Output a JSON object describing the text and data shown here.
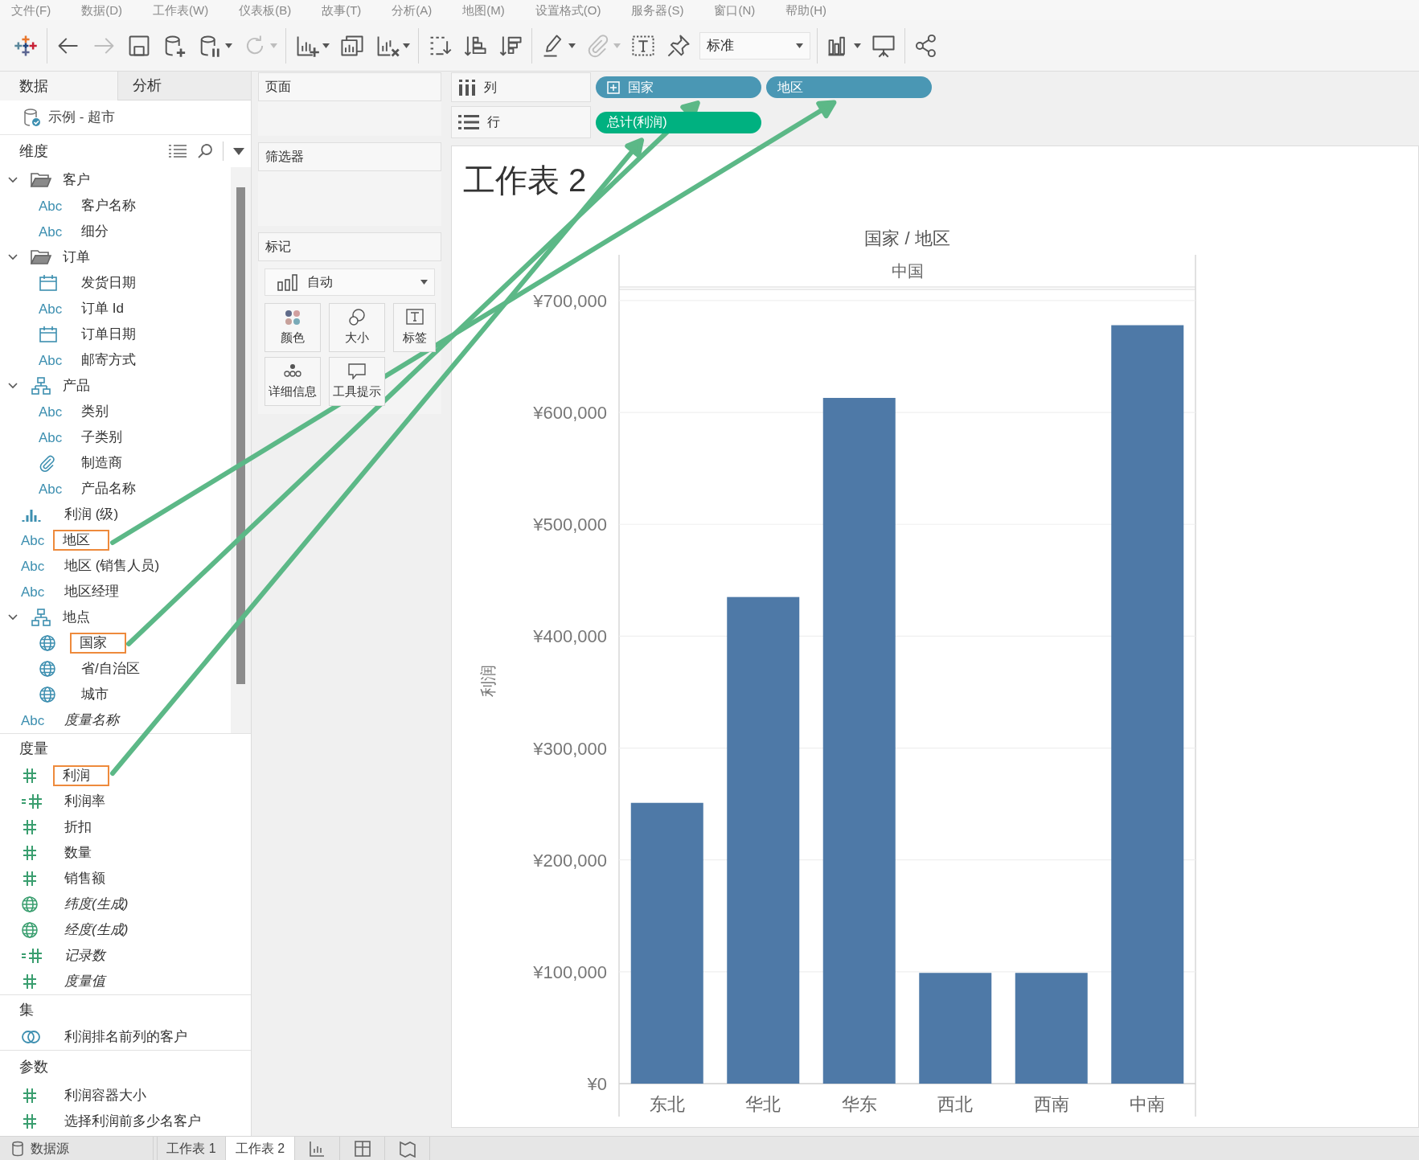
{
  "menu": [
    "文件(F)",
    "数据(D)",
    "工作表(W)",
    "仪表板(B)",
    "故事(T)",
    "分析(A)",
    "地图(M)",
    "设置格式(O)",
    "服务器(S)",
    "窗口(N)",
    "帮助(H)"
  ],
  "toolbar": [
    [
      {
        "kind": "logo",
        "menu": false
      }
    ],
    [
      {
        "kind": "back",
        "disabled": false,
        "menu": false
      },
      {
        "kind": "forward",
        "disabled": true,
        "menu": false
      },
      {
        "kind": "save",
        "disabled": false,
        "menu": false
      },
      {
        "kind": "new-datasource",
        "disabled": false,
        "menu": false
      },
      {
        "kind": "pause",
        "disabled": false,
        "menu": true
      },
      {
        "kind": "refresh",
        "disabled": true,
        "menu": true
      }
    ],
    [
      {
        "kind": "new-sheet",
        "disabled": false,
        "menu": true
      },
      {
        "kind": "duplicate",
        "disabled": false,
        "menu": false
      },
      {
        "kind": "clear",
        "disabled": false,
        "menu": true
      }
    ],
    [
      {
        "kind": "swap",
        "disabled": false,
        "menu": false
      },
      {
        "kind": "sort-asc",
        "disabled": false,
        "menu": false
      },
      {
        "kind": "sort-desc",
        "disabled": false,
        "menu": false
      }
    ],
    [
      {
        "kind": "highlight",
        "disabled": false,
        "menu": true
      },
      {
        "kind": "annotate",
        "disabled": true,
        "menu": true
      },
      {
        "kind": "labels",
        "disabled": false,
        "menu": false
      },
      {
        "kind": "pin",
        "disabled": false,
        "menu": false
      },
      {
        "kind": "fit",
        "value": "标准",
        "disabled": false,
        "menu": true
      }
    ],
    [
      {
        "kind": "show-me",
        "disabled": false,
        "menu": true
      },
      {
        "kind": "presentation",
        "disabled": false,
        "menu": false
      }
    ],
    [
      {
        "kind": "share",
        "disabled": false,
        "menu": false
      }
    ]
  ],
  "left_panel": {
    "tabs": [
      {
        "label": "数据",
        "selected": true
      },
      {
        "label": "分析",
        "selected": false
      }
    ],
    "data_source": "示例 - 超市",
    "sections": [
      {
        "title": "维度",
        "color": "#3d8fb0",
        "has_tools": true,
        "items": [
          {
            "kind": "folder",
            "label": "客户",
            "expanded": true,
            "children": [
              {
                "kind": "text",
                "badge": "Abc",
                "label": "客户名称",
                "italic": false,
                "highlighted": false
              },
              {
                "kind": "text",
                "badge": "Abc",
                "label": "细分",
                "italic": false,
                "highlighted": false
              }
            ]
          },
          {
            "kind": "folder",
            "label": "订单",
            "expanded": true,
            "children": [
              {
                "kind": "date",
                "label": "发货日期",
                "italic": false,
                "highlighted": false
              },
              {
                "kind": "text",
                "badge": "Abc",
                "label": "订单 Id",
                "italic": false,
                "highlighted": false
              },
              {
                "kind": "date",
                "label": "订单日期",
                "italic": false,
                "highlighted": false
              },
              {
                "kind": "text",
                "badge": "Abc",
                "label": "邮寄方式",
                "italic": false,
                "highlighted": false
              }
            ]
          },
          {
            "kind": "hierarchy",
            "label": "产品",
            "expanded": true,
            "children": [
              {
                "kind": "text",
                "badge": "Abc",
                "label": "类别",
                "italic": false,
                "highlighted": false
              },
              {
                "kind": "text",
                "badge": "Abc",
                "label": "子类别",
                "italic": false,
                "highlighted": false
              },
              {
                "kind": "attachment",
                "label": "制造商",
                "italic": false,
                "highlighted": false
              },
              {
                "kind": "text",
                "badge": "Abc",
                "label": "产品名称",
                "italic": false,
                "highlighted": false
              }
            ]
          },
          {
            "kind": "bin",
            "label": "利润 (级)",
            "italic": false,
            "highlighted": false
          },
          {
            "kind": "text",
            "badge": "Abc",
            "label": "地区",
            "italic": false,
            "highlighted": true
          },
          {
            "kind": "text",
            "badge": "Abc",
            "label": "地区 (销售人员)",
            "italic": false,
            "highlighted": false
          },
          {
            "kind": "text",
            "badge": "Abc",
            "label": "地区经理",
            "italic": false,
            "highlighted": false
          },
          {
            "kind": "hierarchy",
            "label": "地点",
            "expanded": true,
            "children": [
              {
                "kind": "geo",
                "label": "国家",
                "italic": false,
                "highlighted": true
              },
              {
                "kind": "geo",
                "label": "省/自治区",
                "italic": false,
                "highlighted": false
              },
              {
                "kind": "geo",
                "label": "城市",
                "italic": false,
                "highlighted": false
              }
            ]
          },
          {
            "kind": "text",
            "badge": "Abc",
            "label": "度量名称",
            "italic": true,
            "highlighted": false
          }
        ]
      },
      {
        "title": "度量",
        "color": "#3a9e6f",
        "has_tools": false,
        "items": [
          {
            "kind": "number",
            "label": "利润",
            "italic": false,
            "highlighted": true
          },
          {
            "kind": "calc-number",
            "label": "利润率",
            "italic": false,
            "highlighted": false
          },
          {
            "kind": "number",
            "label": "折扣",
            "italic": false,
            "highlighted": false
          },
          {
            "kind": "number",
            "label": "数量",
            "italic": false,
            "highlighted": false
          },
          {
            "kind": "number",
            "label": "销售额",
            "italic": false,
            "highlighted": false
          },
          {
            "kind": "geo",
            "label": "纬度(生成)",
            "italic": true,
            "highlighted": false
          },
          {
            "kind": "geo",
            "label": "经度(生成)",
            "italic": true,
            "highlighted": false
          },
          {
            "kind": "calc-number",
            "label": "记录数",
            "italic": true,
            "highlighted": false
          },
          {
            "kind": "number",
            "label": "度量值",
            "italic": true,
            "highlighted": false
          }
        ]
      },
      {
        "title": "集",
        "color": "#3d8fb0",
        "has_tools": false,
        "items": [
          {
            "kind": "set",
            "label": "利润排名前列的客户",
            "italic": false,
            "highlighted": false
          }
        ]
      },
      {
        "title": "参数",
        "color": "#3a9e6f",
        "has_tools": false,
        "items": [
          {
            "kind": "number",
            "label": "利润容器大小",
            "italic": false,
            "highlighted": false
          },
          {
            "kind": "number",
            "label": "选择利润前多少名客户",
            "italic": false,
            "highlighted": false
          }
        ]
      }
    ]
  },
  "cards": {
    "pages": "页面",
    "filters": "筛选器",
    "marks": {
      "title": "标记",
      "mark_type": "自动",
      "buttons": [
        {
          "kind": "color",
          "label": "颜色"
        },
        {
          "kind": "size",
          "label": "大小"
        },
        {
          "kind": "label",
          "label": "标签"
        },
        {
          "kind": "detail",
          "label": "详细信息"
        },
        {
          "kind": "tooltip",
          "label": "工具提示"
        }
      ]
    }
  },
  "shelves": [
    {
      "kind": "columns",
      "label": "列",
      "pills": [
        {
          "label": "国家",
          "color": "#4a97b4",
          "expandable": true
        },
        {
          "label": "地区",
          "color": "#4a97b4",
          "expandable": false
        }
      ]
    },
    {
      "kind": "rows",
      "label": "行",
      "pills": [
        {
          "label": "总计(利润)",
          "color": "#00b180",
          "expandable": false
        }
      ]
    }
  ],
  "sheet": {
    "title": "工作表 2",
    "header": "国家 / 地区",
    "pane": "中国",
    "chart_data": {
      "type": "bar",
      "ylabel": "利润",
      "categories": [
        "东北",
        "华北",
        "华东",
        "西北",
        "西南",
        "中南"
      ],
      "series": [
        {
          "color": "#4e79a7",
          "values": [
            251000,
            435000,
            613000,
            99000,
            99000,
            678000
          ]
        }
      ],
      "ylim": [
        0,
        710000
      ],
      "grid": true,
      "yticks": [
        {
          "value": 0,
          "label": "¥0"
        },
        {
          "value": 100000,
          "label": "¥100,000"
        },
        {
          "value": 200000,
          "label": "¥200,000"
        },
        {
          "value": 300000,
          "label": "¥300,000"
        },
        {
          "value": 400000,
          "label": "¥400,000"
        },
        {
          "value": 500000,
          "label": "¥500,000"
        },
        {
          "value": 600000,
          "label": "¥600,000"
        },
        {
          "value": 700000,
          "label": "¥700,000"
        }
      ]
    }
  },
  "bottom_tabs": [
    {
      "kind": "data-source",
      "label": "数据源",
      "selected": false
    },
    {
      "kind": "sheet",
      "label": "工作表 1",
      "selected": false
    },
    {
      "kind": "sheet",
      "label": "工作表 2",
      "selected": true
    },
    {
      "kind": "new-sheet",
      "selected": false
    },
    {
      "kind": "new-dashboard",
      "selected": false
    },
    {
      "kind": "new-story",
      "selected": false
    }
  ]
}
